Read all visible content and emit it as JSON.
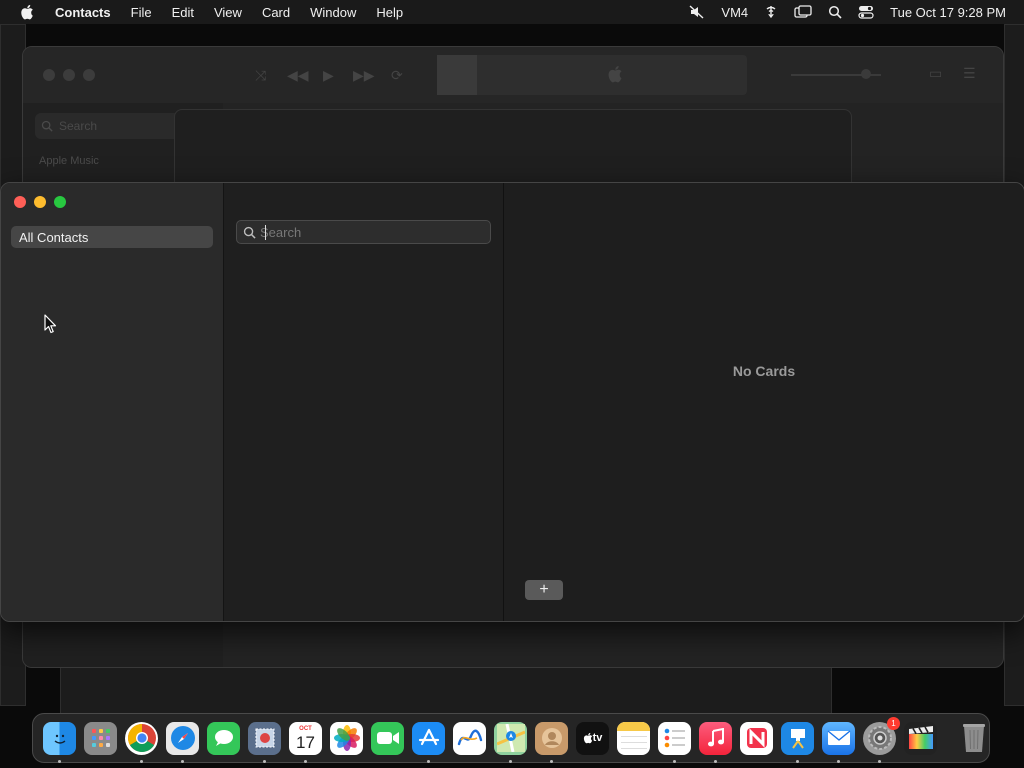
{
  "menubar": {
    "app_name": "Contacts",
    "menus": [
      "File",
      "Edit",
      "View",
      "Card",
      "Window",
      "Help"
    ],
    "status": {
      "keyboard_label": "VM4",
      "clock": "Tue Oct 17  9:28 PM"
    }
  },
  "background_window": {
    "search_placeholder": "Search",
    "section_label": "Apple Music"
  },
  "contacts_window": {
    "sidebar": {
      "groups": [
        "All Contacts"
      ]
    },
    "search": {
      "placeholder": "Search",
      "value": ""
    },
    "detail": {
      "empty_message": "No Cards"
    },
    "add_button_label": "+"
  },
  "dock": {
    "apps": [
      {
        "name": "Finder",
        "icon": "finder-icon"
      },
      {
        "name": "Launchpad",
        "icon": "launchpad-icon"
      },
      {
        "name": "Google Chrome",
        "icon": "chrome-icon"
      },
      {
        "name": "Safari",
        "icon": "safari-icon"
      },
      {
        "name": "Messages",
        "icon": "messages-icon"
      },
      {
        "name": "Mail Stamp",
        "icon": "stamp-icon"
      },
      {
        "name": "Calendar",
        "icon": "calendar-icon",
        "month": "OCT",
        "day": "17"
      },
      {
        "name": "Photos",
        "icon": "photos-icon"
      },
      {
        "name": "FaceTime",
        "icon": "facetime-icon"
      },
      {
        "name": "App Store",
        "icon": "appstore-icon"
      },
      {
        "name": "Freeform",
        "icon": "freeform-icon"
      },
      {
        "name": "Maps",
        "icon": "maps-icon"
      },
      {
        "name": "Contacts",
        "icon": "contacts-icon"
      },
      {
        "name": "Apple TV",
        "icon": "appletv-icon",
        "label": "tv"
      },
      {
        "name": "Notes",
        "icon": "notes-icon"
      },
      {
        "name": "Reminders",
        "icon": "reminders-icon"
      },
      {
        "name": "Music",
        "icon": "music-icon"
      },
      {
        "name": "News",
        "icon": "news-icon"
      },
      {
        "name": "Keynote",
        "icon": "keynote-icon"
      },
      {
        "name": "Mail",
        "icon": "mail-icon"
      },
      {
        "name": "System Settings",
        "icon": "settings-icon",
        "badge": "1"
      },
      {
        "name": "Final Cut Pro",
        "icon": "finalcut-icon"
      },
      {
        "name": "Trash",
        "icon": "trash-icon"
      }
    ]
  },
  "colors": {
    "traffic_red": "#ff5f57",
    "traffic_yellow": "#febc2e",
    "traffic_green": "#28c840",
    "sidebar_selection": "#464646"
  }
}
